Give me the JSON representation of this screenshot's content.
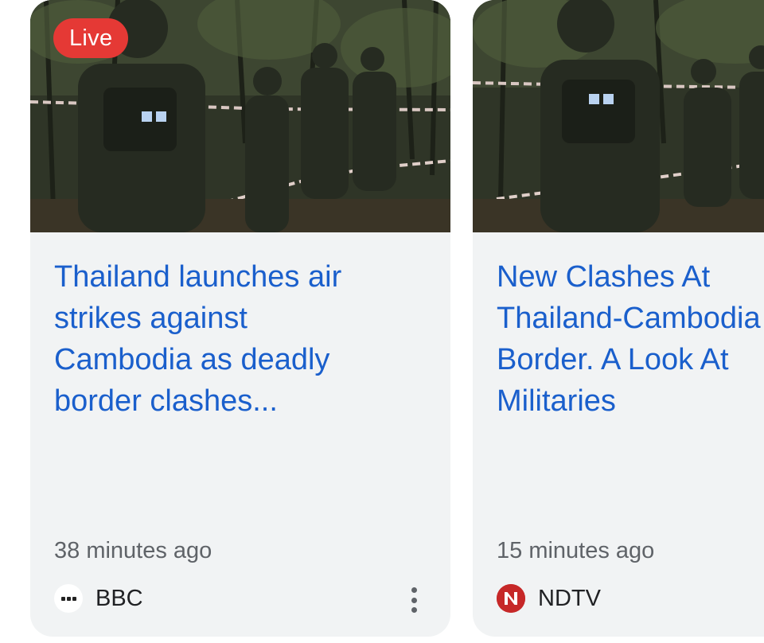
{
  "cards": [
    {
      "badge": "Live",
      "headline": "Thailand launches air\nstrikes against\nCambodia as deadly\nborder clashes...",
      "time": "38 minutes ago",
      "source": "BBC",
      "source_icon": "bbc-logo-icon",
      "image_icon": "soldiers-photo"
    },
    {
      "headline": "New Clashes At\nThailand-Cambodia\nBorder. A Look At\nMilitaries",
      "time": "15 minutes ago",
      "source": "NDTV",
      "source_icon": "ndtv-logo-icon",
      "image_icon": "soldiers-photo"
    }
  ],
  "colors": {
    "headline": "#1a5fcc",
    "live_badge": "#e53935",
    "card_bg": "#f1f3f4",
    "meta_text": "#5f6368"
  }
}
